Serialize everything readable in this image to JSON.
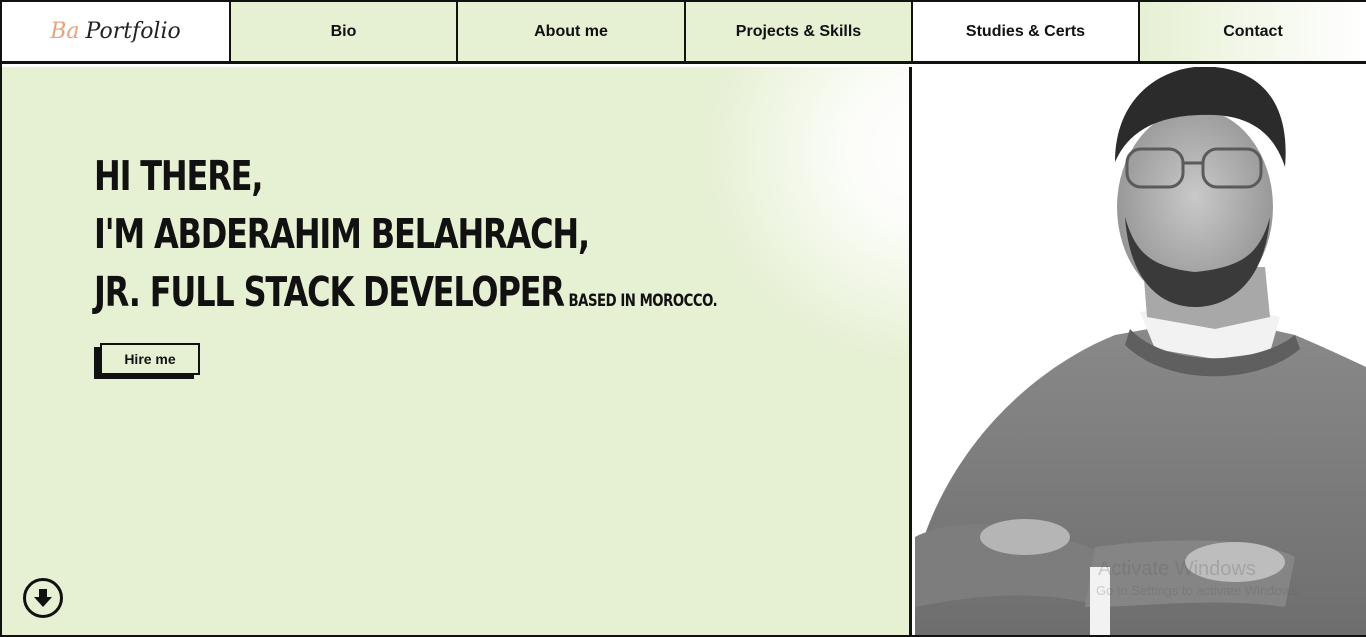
{
  "nav": {
    "logo_prefix": "Ba",
    "logo_name": "Portfolio",
    "items": [
      {
        "label": "Bio"
      },
      {
        "label": "About me"
      },
      {
        "label": "Projects & Skills"
      },
      {
        "label": "Studies & Certs"
      },
      {
        "label": "Contact"
      }
    ]
  },
  "hero": {
    "line1": "Hi there,",
    "line2": "I'm Abderahim Belahrach,",
    "line3": "Jr. Full Stack Developer",
    "line3_small": "based in Morocco.",
    "cta_label": "Hire me",
    "scroll_icon": "arrow-down-circle-icon"
  },
  "photo": {
    "alt": "portrait-photo"
  },
  "watermark": {
    "line1": "Activate Windows",
    "line2": "Go to Settings to activate Windows."
  },
  "colors": {
    "accent_bg": "#e6f0d3",
    "logo_accent": "#e8a27c",
    "ink": "#111111"
  }
}
